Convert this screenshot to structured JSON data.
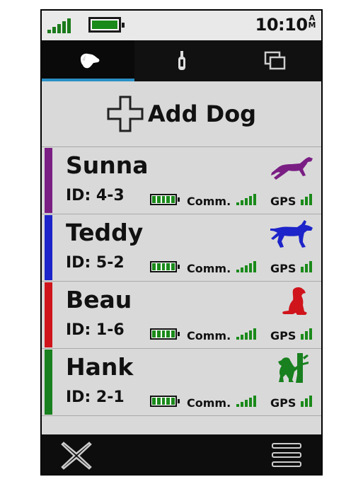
{
  "status": {
    "time": "10:10",
    "ampm_top": "A",
    "ampm_bottom": "M",
    "icons": [
      "signal-strength-icon",
      "battery-icon"
    ]
  },
  "tabs": [
    {
      "icon": "dog-head-icon",
      "active": true
    },
    {
      "icon": "collar-icon",
      "active": false
    },
    {
      "icon": "pages-icon",
      "active": false
    }
  ],
  "add_dog": {
    "label": "Add Dog",
    "icon": "plus-icon"
  },
  "dogs": [
    {
      "name": "Sunna",
      "id": "ID: 4-3",
      "color": "#7a1e84",
      "icon": "running-dog-icon",
      "comm": "Comm.",
      "gps": "GPS"
    },
    {
      "name": "Teddy",
      "id": "ID: 5-2",
      "color": "#1d24c9",
      "icon": "pointing-dog-icon",
      "comm": "Comm.",
      "gps": "GPS"
    },
    {
      "name": "Beau",
      "id": "ID: 1-6",
      "color": "#d0141c",
      "icon": "sitting-dog-icon",
      "comm": "Comm.",
      "gps": "GPS"
    },
    {
      "name": "Hank",
      "id": "ID: 2-1",
      "color": "#18801e",
      "icon": "treed-dog-icon",
      "comm": "Comm.",
      "gps": "GPS"
    }
  ],
  "bottom": {
    "left_icon": "close-icon",
    "right_icon": "menu-icon"
  }
}
